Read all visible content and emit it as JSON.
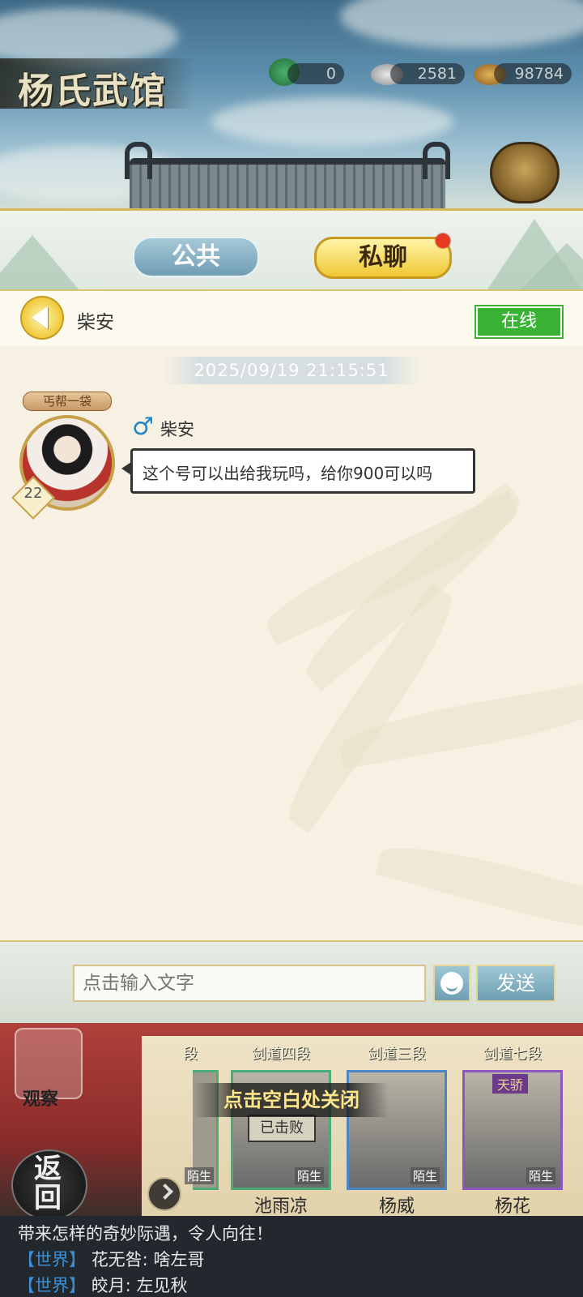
{
  "header": {
    "title": "杨氏武馆",
    "currencies": [
      {
        "icon": "jade-coin-plus-icon",
        "value": "0"
      },
      {
        "icon": "silver-ingot-icon",
        "value": "2581"
      },
      {
        "icon": "copper-coins-icon",
        "value": "98784"
      }
    ]
  },
  "tabs": {
    "public_label": "公共",
    "private_label": "私聊",
    "active": "private",
    "private_has_notification": true
  },
  "chat": {
    "partner_name": "柴安",
    "status": "在线",
    "timestamp": "2025/09/19  21:15:51",
    "message": {
      "rank_badge": "丐帮一袋",
      "level": "22",
      "gender_icon": "male-icon",
      "sender": "柴安",
      "text": "这个号可以出给我玩吗，给你900可以吗"
    }
  },
  "composer": {
    "placeholder": "点击输入文字",
    "send_label": "发送"
  },
  "game": {
    "observe_label": "观察",
    "return_label": "返回",
    "close_hint": "点击空白处关闭",
    "partial_rank": "段",
    "cards": [
      {
        "rank": "剑道四段",
        "name": "池雨凉",
        "tag": "陌生",
        "stamp": "已击败"
      },
      {
        "rank": "剑道三段",
        "name": "杨威",
        "tag": "陌生"
      },
      {
        "rank": "剑道七段",
        "name": "杨花",
        "tag": "陌生",
        "badge": "天骄"
      }
    ],
    "partial_tag": "陌生"
  },
  "world_chat": {
    "first_line": "带来怎样的奇妙际遇，令人向往！",
    "lines": [
      {
        "tag": "【世界】",
        "text": "花无咎: 啥左哥"
      },
      {
        "tag": "【世界】",
        "text": "皎月: 左见秋"
      }
    ]
  }
}
